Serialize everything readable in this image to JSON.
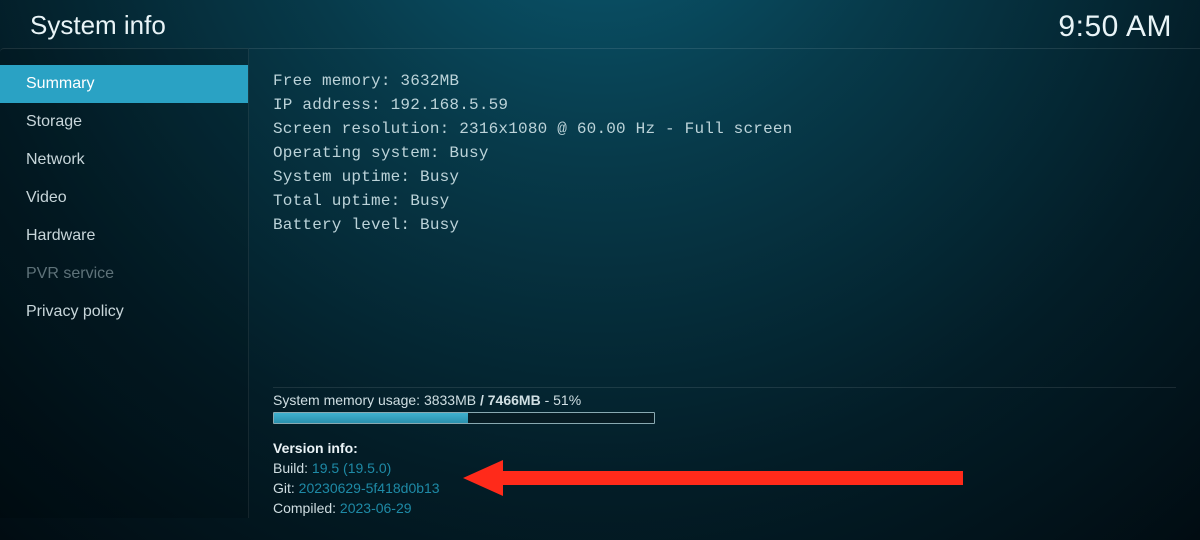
{
  "header": {
    "title": "System info",
    "clock": "9:50 AM"
  },
  "sidebar": {
    "items": [
      {
        "label": "Summary",
        "selected": true
      },
      {
        "label": "Storage",
        "selected": false
      },
      {
        "label": "Network",
        "selected": false
      },
      {
        "label": "Video",
        "selected": false
      },
      {
        "label": "Hardware",
        "selected": false
      },
      {
        "label": "PVR service",
        "selected": false,
        "disabled": true
      },
      {
        "label": "Privacy policy",
        "selected": false
      }
    ]
  },
  "summary": {
    "lines": [
      "Free memory: 3632MB",
      "IP address: 192.168.5.59",
      "Screen resolution: 2316x1080 @ 60.00 Hz - Full screen",
      "Operating system: Busy",
      "System uptime: Busy",
      "Total uptime: Busy",
      "Battery level: Busy"
    ]
  },
  "memory": {
    "label_prefix": "System memory usage: ",
    "used": "3833MB",
    "sep1": " / ",
    "total": "7466MB",
    "sep2": " - ",
    "percent_text": "51%",
    "percent": 51
  },
  "version": {
    "heading": "Version info:",
    "build_key": "Build: ",
    "build_val": "19.5 (19.5.0)",
    "git_key": "Git: ",
    "git_val": "20230629-5f418d0b13",
    "compiled_key": "Compiled: ",
    "compiled_val": "2023-06-29"
  },
  "annotation": {
    "arrow_color": "#ff2a1a"
  }
}
